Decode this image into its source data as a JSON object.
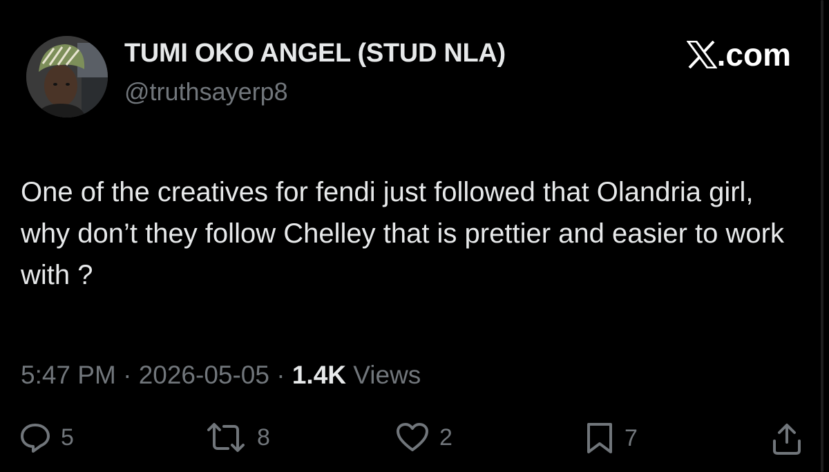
{
  "tweet": {
    "author": {
      "display_name": "TUMI OKO ANGEL (STUD NLA)",
      "handle": "@truthsayerp8",
      "avatar_icon": "profile-photo"
    },
    "brand": {
      "label": ".com",
      "icon": "x-logo-icon"
    },
    "text": "One of the creatives for fendi just followed that Olandria girl, why don’t they follow Chelley that is prettier and easier to work with ?",
    "time": "5:47 PM",
    "separator": "·",
    "date": "2026-05-05",
    "views_count": "1.4K",
    "views_label": "Views",
    "actions": {
      "replies": "5",
      "reposts": "8",
      "likes": "2",
      "bookmarks": "7"
    }
  },
  "colors": {
    "background": "#000000",
    "primary_text": "#e7e9ea",
    "secondary_text": "#71767b"
  }
}
